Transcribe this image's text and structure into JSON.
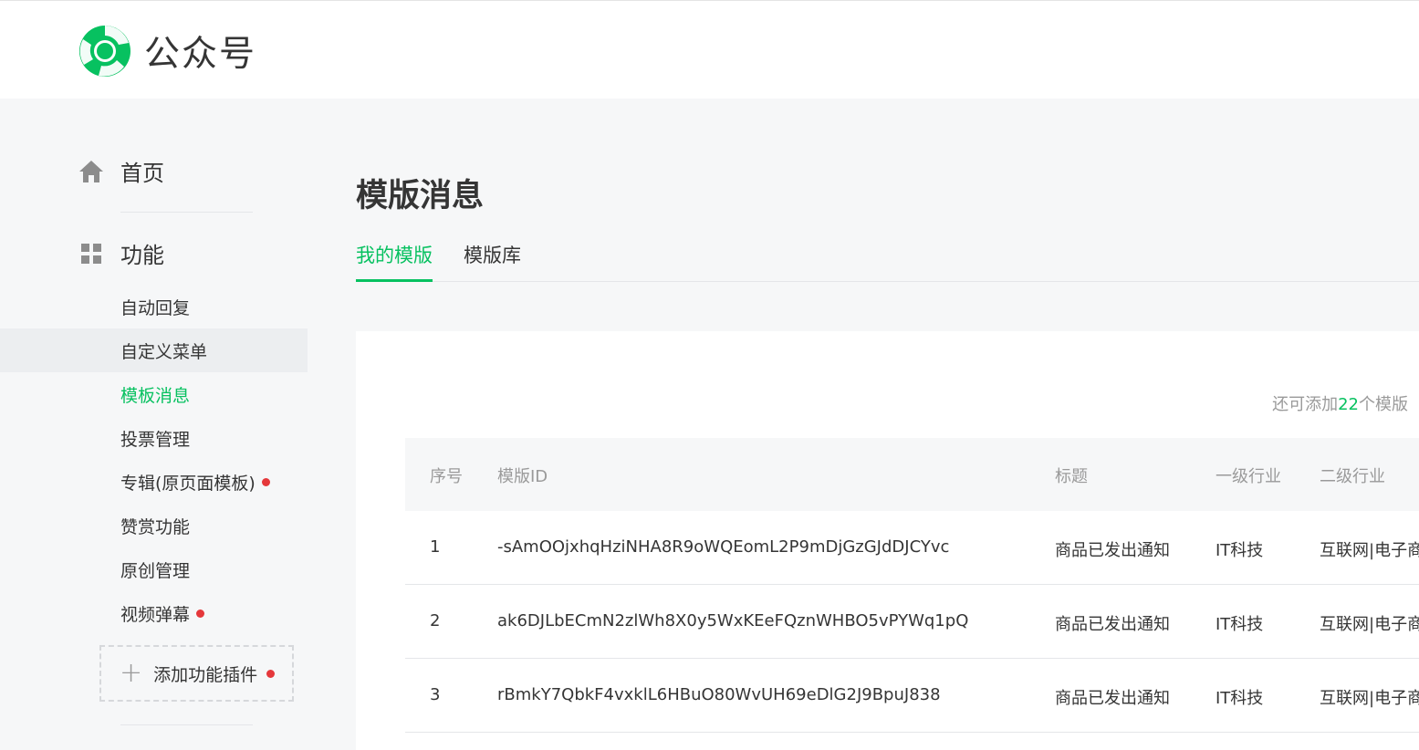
{
  "header": {
    "logo_text": "公众号"
  },
  "sidebar": {
    "home_label": "首页",
    "functions_label": "功能",
    "items": [
      {
        "label": "自动回复",
        "new": false
      },
      {
        "label": "自定义菜单",
        "new": false
      },
      {
        "label": "模板消息",
        "new": false
      },
      {
        "label": "投票管理",
        "new": false
      },
      {
        "label": "专辑(原页面模板)",
        "new": true
      },
      {
        "label": "赞赏功能",
        "new": false
      },
      {
        "label": "原创管理",
        "new": false
      },
      {
        "label": "视频弹幕",
        "new": true
      }
    ],
    "add_plugin_label": "添加功能插件",
    "add_plugin_new": true
  },
  "main": {
    "title": "模版消息",
    "tabs": [
      {
        "label": "我的模版",
        "active": true
      },
      {
        "label": "模版库",
        "active": false
      }
    ],
    "remaining": {
      "prefix": "还可添加",
      "count": "22",
      "suffix": "个模版"
    },
    "table": {
      "headers": [
        "序号",
        "模版ID",
        "标题",
        "一级行业",
        "二级行业"
      ],
      "rows": [
        [
          "1",
          "-sAmOOjxhqHziNHA8R9oWQEomL2P9mDjGzGJdDJCYvc",
          "商品已发出通知",
          "IT科技",
          "互联网|电子商务"
        ],
        [
          "2",
          "ak6DJLbECmN2zlWh8X0y5WxKEeFQznWHBO5vPYWq1pQ",
          "商品已发出通知",
          "IT科技",
          "互联网|电子商务"
        ],
        [
          "3",
          "rBmkY7QbkF4vxklL6HBuO80WvUH69eDlG2J9BpuJ838",
          "商品已发出通知",
          "IT科技",
          "互联网|电子商务"
        ]
      ]
    }
  },
  "colors": {
    "accent": "#07c160",
    "new_dot": "#e5383b",
    "text": "#353535",
    "muted": "#9a9a9a"
  },
  "icons": {
    "logo": "wechat-mp-logo-icon",
    "home": "home-icon",
    "functions": "grid-icon",
    "add": "plus-icon"
  }
}
